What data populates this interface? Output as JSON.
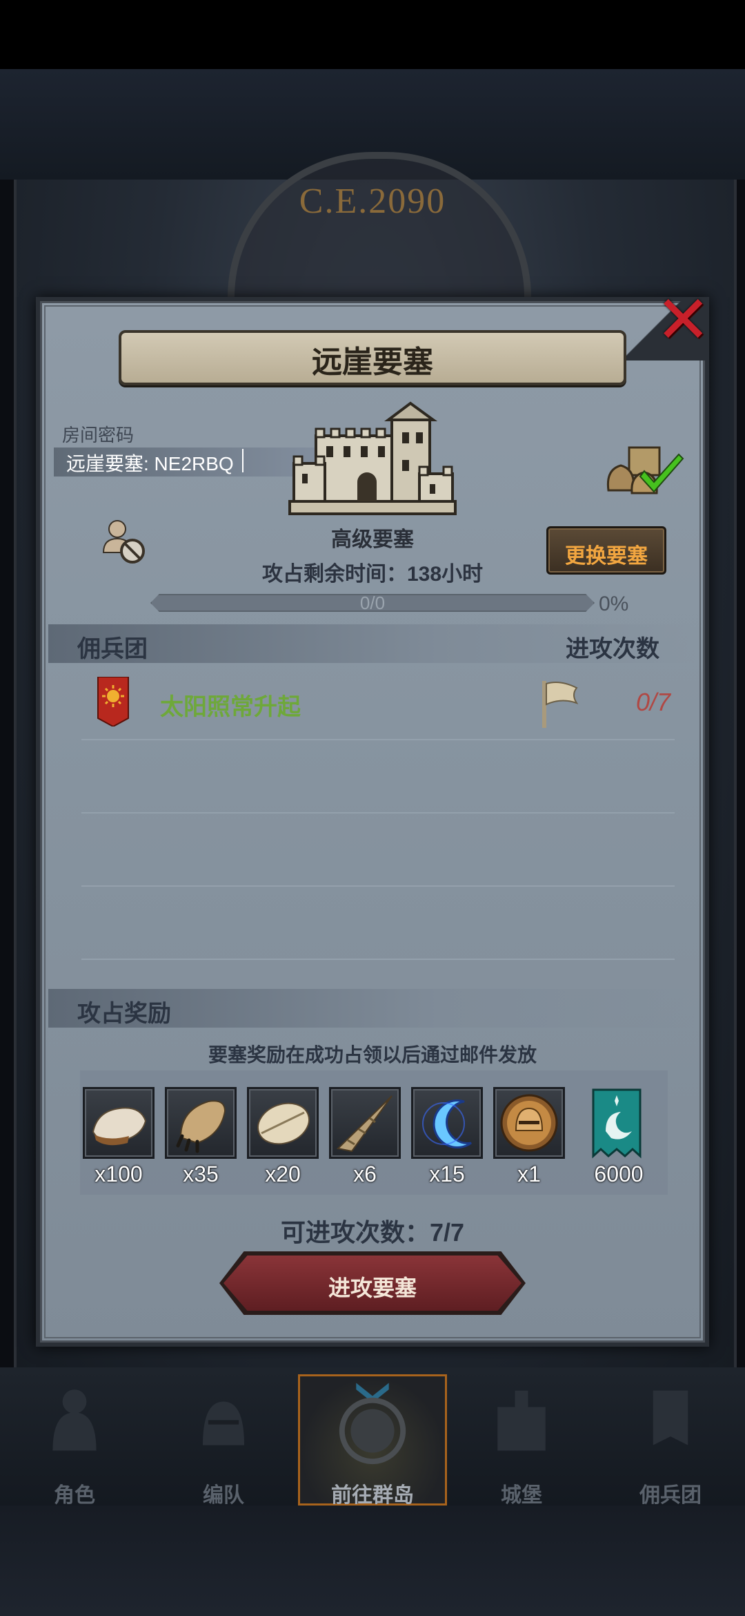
{
  "background": {
    "era_text": "C.E.2090"
  },
  "modal": {
    "title": "远崖要塞",
    "room_code_label": "房间密码",
    "room_code_value": "远崖要塞: NE2RBQ",
    "fortress_level": "高级要塞",
    "change_button": "更换要塞",
    "remaining_time": "攻占剩余时间：138小时",
    "progress_text": "0/0",
    "progress_percent": "0%",
    "progress_value": 0,
    "mercenary_header": "佣兵团",
    "attack_count_header": "进攻次数",
    "mercenaries": [
      {
        "name": "太阳照常升起",
        "attacks": "0/7"
      }
    ],
    "reward_header": "攻占奖励",
    "reward_note": "要塞奖励在成功占领以后通过邮件发放",
    "rewards": [
      {
        "icon": "fur-pelt-icon",
        "qty": "x100"
      },
      {
        "icon": "beast-claw-icon",
        "qty": "x35"
      },
      {
        "icon": "feather-hide-icon",
        "qty": "x20"
      },
      {
        "icon": "horn-icon",
        "qty": "x6"
      },
      {
        "icon": "blue-crescent-icon",
        "qty": "x15"
      },
      {
        "icon": "knight-helmet-medal-icon",
        "qty": "x1"
      },
      {
        "icon": "guild-banner-icon",
        "qty": "6000"
      }
    ],
    "attempts_left": "可进攻次数：7/7",
    "attack_button": "进攻要塞"
  },
  "nav": {
    "items": [
      {
        "label": "角色",
        "active": false
      },
      {
        "label": "编队",
        "active": false
      },
      {
        "label": "前往群岛",
        "active": true
      },
      {
        "label": "城堡",
        "active": false
      },
      {
        "label": "佣兵团",
        "active": false
      }
    ]
  },
  "colors": {
    "accent_gold": "#f2a640",
    "merc_green": "#6ea83a",
    "count_red": "#b04844",
    "close_red": "#c8202a"
  }
}
